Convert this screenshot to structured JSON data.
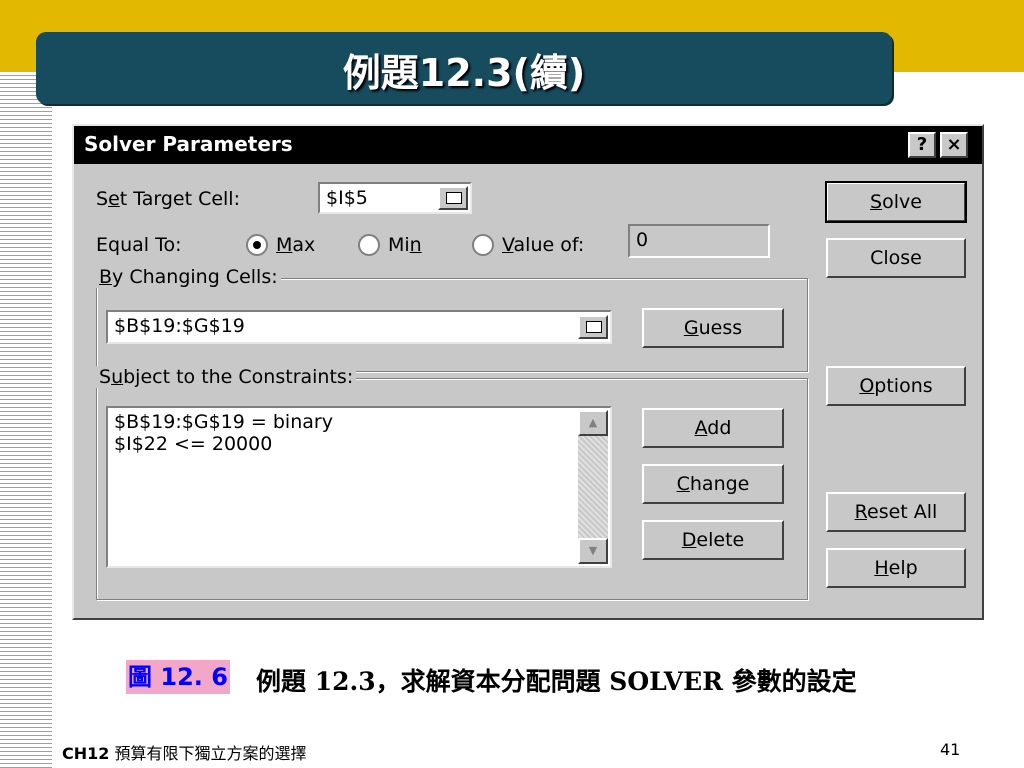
{
  "slide": {
    "title": "例題12.3(續)",
    "footer_chapter": "CH12",
    "footer_title": "預算有限下獨立方案的選擇",
    "page_number": "41"
  },
  "dialog": {
    "title": "Solver Parameters",
    "help_button": "?",
    "close_button": "×",
    "set_target_label_pre": "S",
    "set_target_label_u": "e",
    "set_target_label_post": "t Target Cell:",
    "target_cell_value": "$I$5",
    "equal_to_label": "Equal To:",
    "radio_max_u": "M",
    "radio_max_post": "ax",
    "radio_min_pre": "Mi",
    "radio_min_u": "n",
    "radio_value_u": "V",
    "radio_value_post": "alue of:",
    "value_of": "0",
    "changing_cells_u": "B",
    "changing_cells_post": "y Changing Cells:",
    "changing_cells_value": "$B$19:$G$19",
    "guess_u": "G",
    "guess_post": "uess",
    "constraints_pre": "S",
    "constraints_u": "u",
    "constraints_post": "bject to the Constraints:",
    "constraints": [
      "$B$19:$G$19 = binary",
      "$I$22 <= 20000"
    ],
    "add_u": "A",
    "add_post": "dd",
    "change_u": "C",
    "change_post": "hange",
    "delete_u": "D",
    "delete_post": "elete",
    "solve_u": "S",
    "solve_post": "olve",
    "close_label": "Close",
    "options_u": "O",
    "options_post": "ptions",
    "reset_u": "R",
    "reset_post": "eset All",
    "help_u": "H",
    "help_post": "elp"
  },
  "caption": {
    "figure_number": "圖 12. 6",
    "text": "例題 12.3，求解資本分配問題 SOLVER 參數的設定"
  }
}
